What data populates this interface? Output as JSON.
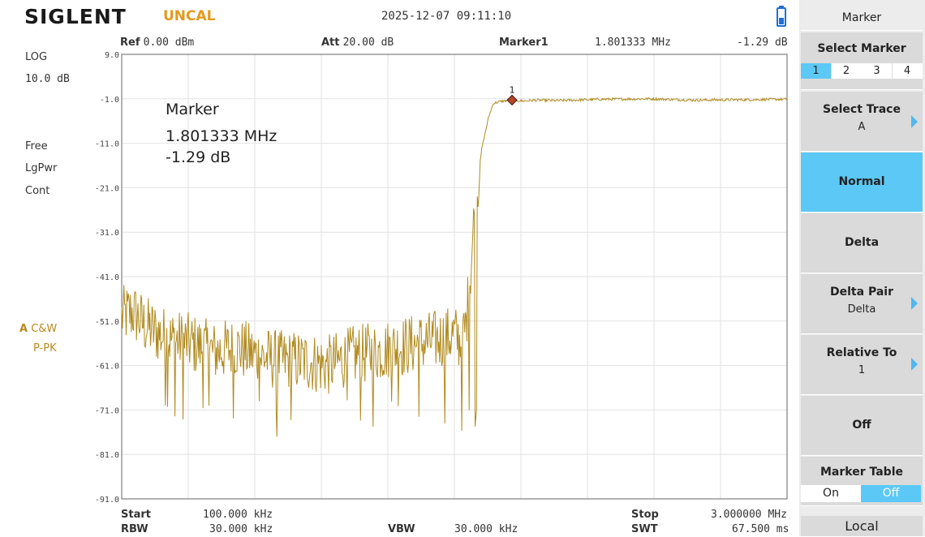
{
  "header": {
    "brand": "SIGLENT",
    "status": "UNCAL",
    "datetime": "2025-12-07  09:11:10"
  },
  "left_panel": {
    "scale_type": "LOG",
    "scale_div": "10.0 dB",
    "trigger": "Free",
    "detector": "LgPwr",
    "sweep_mode": "Cont",
    "trace_letter": "A",
    "trace_mode": "C&W",
    "trace_detect": "P-PK"
  },
  "plot_header": {
    "ref_label": "Ref",
    "ref_value": "0.00 dBm",
    "att_label": "Att",
    "att_value": "20.00 dB",
    "marker_label": "Marker1",
    "marker_freq": "1.801333 MHz",
    "marker_level": "-1.29 dB"
  },
  "marker_readout": {
    "title": "Marker",
    "freq": "1.801333 MHz",
    "level": "-1.29 dB",
    "marker_num": "1"
  },
  "footer": {
    "start_label": "Start",
    "start_value": "100.000 kHz",
    "rbw_label": "RBW",
    "rbw_value": "30.000 kHz",
    "vbw_label": "VBW",
    "vbw_value": "30.000 kHz",
    "stop_label": "Stop",
    "stop_value": "3.000000 MHz",
    "swt_label": "SWT",
    "swt_value": "67.500 ms"
  },
  "softkeys": {
    "title": "Marker",
    "select_marker": "Select Marker",
    "marker_options": [
      "1",
      "2",
      "3",
      "4"
    ],
    "selected_marker_index": 0,
    "select_trace": "Select Trace",
    "select_trace_value": "A",
    "normal": "Normal",
    "delta": "Delta",
    "delta_pair": "Delta Pair",
    "delta_pair_value": "Delta",
    "relative_to": "Relative To",
    "relative_to_value": "1",
    "off": "Off",
    "marker_table": "Marker Table",
    "on_label": "On",
    "off_label": "Off",
    "marker_table_state": "Off",
    "local": "Local"
  },
  "colors": {
    "trace": "#b08a1e",
    "accent": "#5cc8f5",
    "marker": "#b5452a",
    "uncal": "#e39a1c"
  },
  "chart_data": {
    "type": "line",
    "xlabel": "",
    "ylabel": "",
    "xlim_mhz": [
      0.1,
      3.0
    ],
    "ylim": [
      -91.0,
      9.0
    ],
    "ytick_labels": [
      "9.0",
      "-1.0",
      "-11.0",
      "-21.0",
      "-31.0",
      "-41.0",
      "-51.0",
      "-61.0",
      "-71.0",
      "-81.0",
      "-91.0"
    ],
    "grid": true,
    "series": [
      {
        "x": [
          0.1,
          0.15,
          0.2,
          0.3,
          0.4,
          0.5,
          0.6,
          0.7,
          0.8,
          0.9,
          1.0,
          1.1,
          1.2,
          1.3,
          1.4,
          1.5,
          1.55,
          1.58,
          1.6,
          1.62,
          1.64,
          1.67,
          1.7,
          1.72,
          1.75,
          1.78,
          1.8,
          1.85,
          1.9,
          2.0,
          2.2,
          2.4,
          2.6,
          2.8,
          3.0
        ],
        "y": [
          -50,
          -49,
          -52,
          -55,
          -56,
          -58,
          -57,
          -59,
          -60,
          -60,
          -61,
          -59,
          -58,
          -57,
          -56,
          -55,
          -54,
          -56,
          -52,
          -40,
          -25,
          -12,
          -5,
          -2,
          -1.6,
          -1.4,
          -1.29,
          -1.5,
          -1.3,
          -1.4,
          -1.1,
          -1.0,
          -1.3,
          -1.2,
          -1.1
        ]
      }
    ],
    "noise_floor_spread": {
      "x_range_mhz": [
        0.1,
        1.66
      ],
      "typical_minimum_db": -68,
      "deepest_dip_db": -77
    },
    "marker": {
      "x_mhz": 1.801333,
      "y": -1.29
    }
  }
}
